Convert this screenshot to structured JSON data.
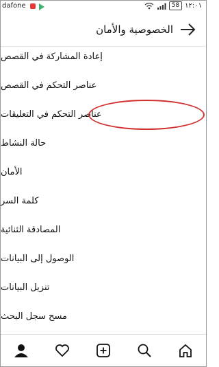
{
  "status_bar": {
    "carrier": "dafone",
    "battery": "58",
    "time": "١٢:٠١"
  },
  "header": {
    "title": "الخصوصية والأمان",
    "back_icon": "arrow-right-icon"
  },
  "menu_items": [
    {
      "label": "إعادة المشاركة في القصص"
    },
    {
      "label": "عناصر التحكم في القصص"
    },
    {
      "label": "عناصر التحكم في التعليقات"
    },
    {
      "label": "حالة النشاط"
    },
    {
      "label": "الأمان"
    },
    {
      "label": "كلمة السر"
    },
    {
      "label": "المصادقة الثنائية"
    },
    {
      "label": "الوصول إلى البيانات"
    },
    {
      "label": "تنزيل البيانات"
    },
    {
      "label": "مسح سجل البحث"
    }
  ],
  "bottom_nav": [
    "profile-icon",
    "heart-icon",
    "add-icon",
    "search-icon",
    "home-icon"
  ],
  "colors": {
    "annotation": "#d32f2f"
  }
}
